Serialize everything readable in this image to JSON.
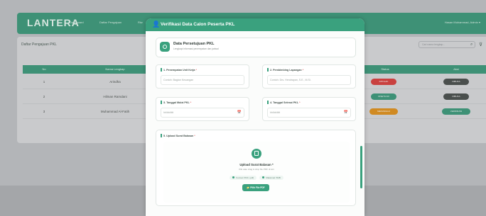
{
  "app": {
    "brand": "LANTERA",
    "nav": [
      "Dashboard",
      "Daftar Pengajuan",
      "Riw"
    ],
    "user": "Hasan Muhammad, Admin ▾"
  },
  "list": {
    "title": "Daftar Pengajuan PKL",
    "search_placeholder": "Cari nama lengkap...",
    "headers": [
      "No",
      "Nama Lengkap",
      "Status",
      "Aksi"
    ],
    "rows": [
      {
        "no": "1",
        "name": "Arindha",
        "status": "DITOLAK",
        "action": "DIBUKA"
      },
      {
        "no": "2",
        "name": "Hilman Ramdani",
        "status": "DISETUJUI",
        "action": "DIBUKA"
      },
      {
        "no": "3",
        "name": "Muhammad Al-Fatih",
        "status": "MENUNGGU",
        "action": "VERIFIKASI"
      }
    ],
    "colors": {
      "ditolak": "#c9413f",
      "disetujui": "#3e9176",
      "menunggu": "#d08a22",
      "dibuka": "#4a4f4d"
    }
  },
  "modal": {
    "title": "Verifikasi Data Calon Peserta PKL",
    "header_icon": "user-check-icon",
    "section": {
      "title": "Data Persetujuan PKL",
      "subtitle": "Lengkapi informasi penempatan dan jadwal"
    },
    "fields": {
      "unit_kerja": {
        "label": "1. Penempatan Unit Kerja",
        "placeholder": "Contoh: Bagian Keuangan"
      },
      "pembimbing": {
        "label": "2. Pembimbing Lapangan",
        "placeholder": "Contoh: Drs. Hendrayan, S.E., M.Si."
      },
      "tgl_mulai": {
        "label": "3. Tanggal Mulai PKL",
        "placeholder": "hh/bb/tttt"
      },
      "tgl_selesai": {
        "label": "4. Tanggal Selesai PKL",
        "placeholder": "hh/bb/tttt"
      }
    },
    "upload": {
      "label": "5. Upload Surat Balasan",
      "title": "Upload Surat Balasan *",
      "subtitle": "Klik atau drag & drop file PDF di sini",
      "chips": [
        "Format: PDF (.pdf)",
        "Maksimal: 5MB"
      ],
      "button": "Pilih File PDF"
    },
    "accent": "#3aa17e"
  }
}
